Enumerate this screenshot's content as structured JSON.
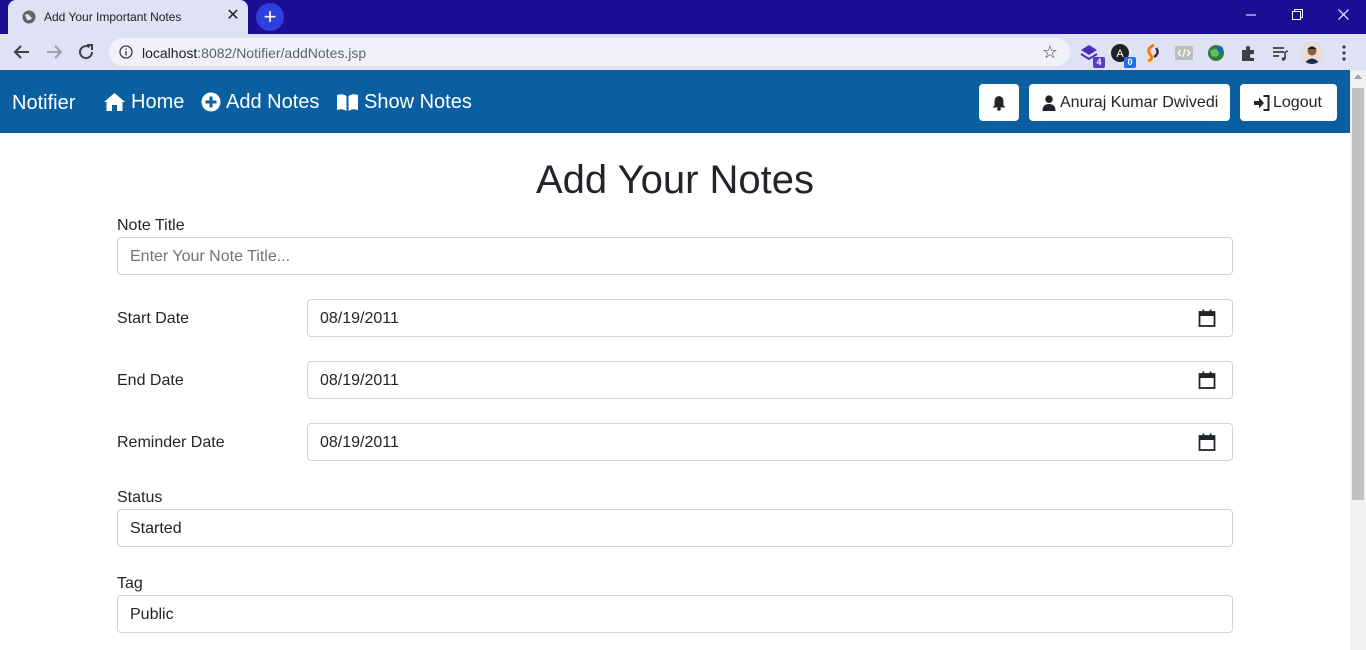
{
  "browser": {
    "tab_title": "Add Your Important Notes",
    "tab_close": "✕",
    "new_tab": "+",
    "url_host": "localhost",
    "url_path": ":8082/Notifier/addNotes.jsp",
    "extensions": [
      {
        "name": "extension-1",
        "badge": "4",
        "badge_color": "#5b3cc4"
      },
      {
        "name": "extension-2",
        "badge": "0",
        "badge_color": "#1a73e8"
      }
    ]
  },
  "navbar": {
    "brand": "Notifier",
    "links": [
      {
        "label": "Home",
        "icon": "home-icon"
      },
      {
        "label": "Add Notes",
        "icon": "plus-circle-icon"
      },
      {
        "label": "Show Notes",
        "icon": "book-icon"
      }
    ],
    "user_name": "Anuraj Kumar Dwivedi",
    "logout_label": "Logout",
    "bg_color": "#0a5fa1"
  },
  "form": {
    "heading": "Add Your Notes",
    "note_title": {
      "label": "Note Title",
      "placeholder": "Enter Your Note Title..."
    },
    "start_date": {
      "label": "Start Date",
      "value": "08/19/2011"
    },
    "end_date": {
      "label": "End Date",
      "value": "08/19/2011"
    },
    "reminder_date": {
      "label": "Reminder Date",
      "value": "08/19/2011"
    },
    "status": {
      "label": "Status",
      "value": "Started"
    },
    "tag": {
      "label": "Tag",
      "value": "Public"
    }
  }
}
